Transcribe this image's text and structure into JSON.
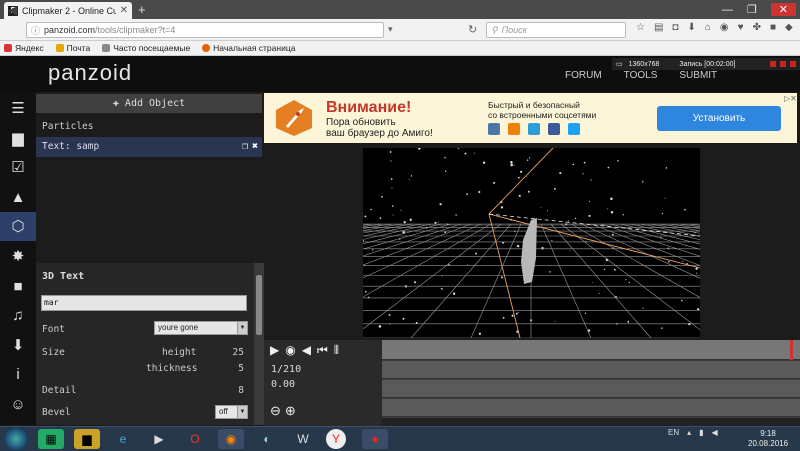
{
  "browser": {
    "tab_title": "Clipmaker 2 - Online Custo...",
    "tab_favicon": "F",
    "url_host": "panzoid.com",
    "url_path": "/tools/clipmaker?t=4",
    "search_placeholder": "Поиск",
    "bookmarks": [
      "Яндекс",
      "Почта",
      "Часто посещаемые",
      "Начальная страница"
    ]
  },
  "site": {
    "logo": "panzoid",
    "nav": [
      "FORUM",
      "TOOLS",
      "SUBMIT"
    ]
  },
  "recorder": {
    "resolution": "1360x768",
    "status": "Запись [00:02:00]"
  },
  "sidebar": {
    "items": [
      {
        "icon": "menu-icon",
        "glyph": "☰"
      },
      {
        "icon": "folder-icon",
        "glyph": "▆"
      },
      {
        "icon": "checkbox-icon",
        "glyph": "☑"
      },
      {
        "icon": "image-icon",
        "glyph": "▲"
      },
      {
        "icon": "cube-icon",
        "glyph": "⬡"
      },
      {
        "icon": "burst-icon",
        "glyph": "✸"
      },
      {
        "icon": "camera-icon",
        "glyph": "■"
      },
      {
        "icon": "music-icon",
        "glyph": "♫"
      },
      {
        "icon": "download-icon",
        "glyph": "⬇"
      },
      {
        "icon": "info-icon",
        "glyph": "i"
      },
      {
        "icon": "smiley-icon",
        "glyph": "☺"
      }
    ]
  },
  "objects": {
    "add_label": "Add Object",
    "section": "Particles",
    "selected": "Text: samp"
  },
  "properties": {
    "title": "3D Text",
    "text_value": "mar",
    "font_label": "Font",
    "font_value": "youre gone",
    "size_label": "Size",
    "height_label": "height",
    "height_value": "25",
    "thickness_label": "thickness",
    "thickness_value": "5",
    "detail_label": "Detail",
    "detail_value": "8",
    "bevel_label": "Bevel",
    "bevel_value": "off"
  },
  "ad": {
    "headline": "Внимание!",
    "line1": "Пора обновить",
    "line2": "ваш браузер до Амиго!",
    "right1": "Быстрый и безопасный",
    "right2": "со встроенными соцсетями",
    "button": "Установить",
    "social_colors": [
      "#4a76a8",
      "#ee8208",
      "#2d9cdb",
      "#3b5998",
      "#1da1f2"
    ]
  },
  "timeline": {
    "frame": "1/210",
    "time": "0.00"
  },
  "taskbar": {
    "lang": "EN",
    "time": "9:18",
    "date": "20.08.2016"
  },
  "colors": {
    "accent": "#2e3f6a",
    "ad_button": "#2e86de",
    "ad_headline": "#c0392b"
  }
}
